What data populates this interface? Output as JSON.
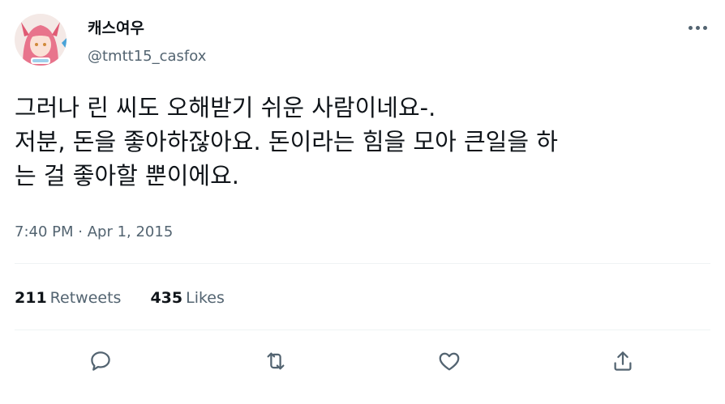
{
  "author": {
    "name": "캐스여우",
    "handle": "@tmtt15_casfox"
  },
  "tweet": {
    "text": "그러나 린 씨도 오해받기 쉬운 사람이네요-.\n저분, 돈을 좋아하잖아요. 돈이라는 힘을 모아 큰일을 하\n는 걸 좋아할 뿐이에요.",
    "time": "7:40 PM",
    "separator": " · ",
    "date": "Apr 1, 2015"
  },
  "stats": {
    "retweets_count": "211",
    "retweets_label": "Retweets",
    "likes_count": "435",
    "likes_label": "Likes"
  },
  "icons": {
    "more": "more-horizontal-icon",
    "reply": "reply-icon",
    "retweet": "retweet-icon",
    "like": "heart-icon",
    "share": "share-icon"
  },
  "colors": {
    "text_primary": "#0f1419",
    "text_secondary": "#536471",
    "divider": "#eff3f4"
  }
}
